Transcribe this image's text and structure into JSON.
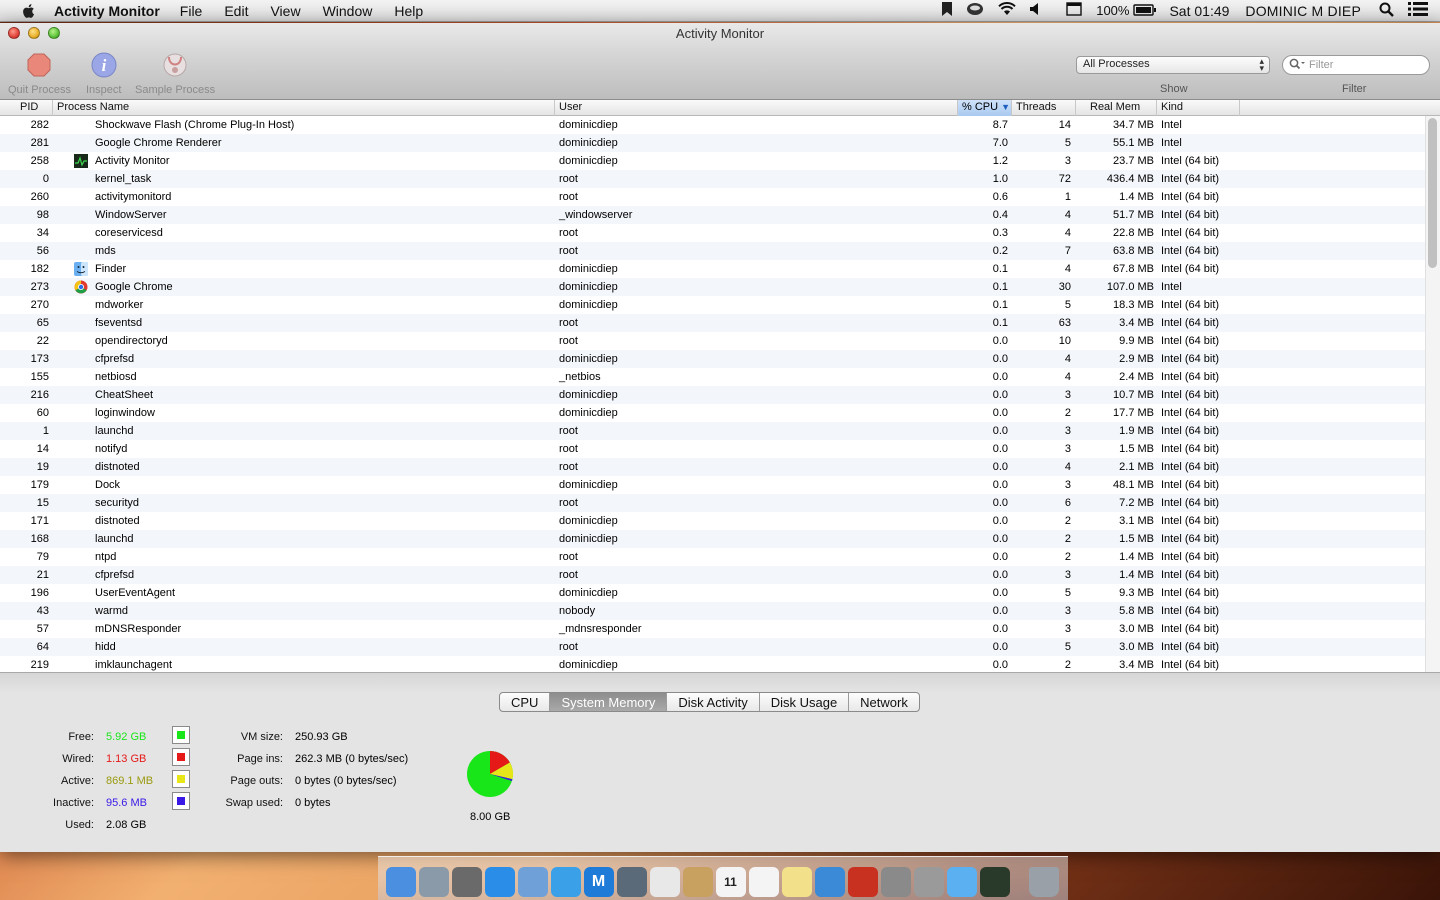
{
  "menubar": {
    "app_name": "Activity Monitor",
    "menus": [
      "File",
      "Edit",
      "View",
      "Window",
      "Help"
    ],
    "battery": "100%",
    "clock": "Sat 01:49",
    "user": "DOMINIC M DIEP"
  },
  "window": {
    "title": "Activity Monitor",
    "toolbar": {
      "quit_label": "Quit Process",
      "inspect_label": "Inspect",
      "sample_label": "Sample Process",
      "show_value": "All Processes",
      "show_label": "Show",
      "filter_placeholder": "Filter",
      "filter_label": "Filter"
    }
  },
  "table": {
    "columns": [
      "PID",
      "Process Name",
      "User",
      "% CPU",
      "Threads",
      "Real Mem",
      "Kind"
    ],
    "sorted_column": "% CPU",
    "rows": [
      {
        "pid": "282",
        "name": "Shockwave Flash (Chrome Plug-In Host)",
        "user": "dominicdiep",
        "cpu": "8.7",
        "threads": "14",
        "mem": "34.7 MB",
        "kind": "Intel",
        "icon": ""
      },
      {
        "pid": "281",
        "name": "Google Chrome Renderer",
        "user": "dominicdiep",
        "cpu": "7.0",
        "threads": "5",
        "mem": "55.1 MB",
        "kind": "Intel",
        "icon": ""
      },
      {
        "pid": "258",
        "name": "Activity Monitor",
        "user": "dominicdiep",
        "cpu": "1.2",
        "threads": "3",
        "mem": "23.7 MB",
        "kind": "Intel (64 bit)",
        "icon": "activity-monitor-icon"
      },
      {
        "pid": "0",
        "name": "kernel_task",
        "user": "root",
        "cpu": "1.0",
        "threads": "72",
        "mem": "436.4 MB",
        "kind": "Intel (64 bit)",
        "icon": ""
      },
      {
        "pid": "260",
        "name": "activitymonitord",
        "user": "root",
        "cpu": "0.6",
        "threads": "1",
        "mem": "1.4 MB",
        "kind": "Intel (64 bit)",
        "icon": ""
      },
      {
        "pid": "98",
        "name": "WindowServer",
        "user": "_windowserver",
        "cpu": "0.4",
        "threads": "4",
        "mem": "51.7 MB",
        "kind": "Intel (64 bit)",
        "icon": ""
      },
      {
        "pid": "34",
        "name": "coreservicesd",
        "user": "root",
        "cpu": "0.3",
        "threads": "4",
        "mem": "22.8 MB",
        "kind": "Intel (64 bit)",
        "icon": ""
      },
      {
        "pid": "56",
        "name": "mds",
        "user": "root",
        "cpu": "0.2",
        "threads": "7",
        "mem": "63.8 MB",
        "kind": "Intel (64 bit)",
        "icon": ""
      },
      {
        "pid": "182",
        "name": "Finder",
        "user": "dominicdiep",
        "cpu": "0.1",
        "threads": "4",
        "mem": "67.8 MB",
        "kind": "Intel (64 bit)",
        "icon": "finder-icon"
      },
      {
        "pid": "273",
        "name": "Google Chrome",
        "user": "dominicdiep",
        "cpu": "0.1",
        "threads": "30",
        "mem": "107.0 MB",
        "kind": "Intel",
        "icon": "chrome-icon"
      },
      {
        "pid": "270",
        "name": "mdworker",
        "user": "dominicdiep",
        "cpu": "0.1",
        "threads": "5",
        "mem": "18.3 MB",
        "kind": "Intel (64 bit)",
        "icon": ""
      },
      {
        "pid": "65",
        "name": "fseventsd",
        "user": "root",
        "cpu": "0.1",
        "threads": "63",
        "mem": "3.4 MB",
        "kind": "Intel (64 bit)",
        "icon": ""
      },
      {
        "pid": "22",
        "name": "opendirectoryd",
        "user": "root",
        "cpu": "0.0",
        "threads": "10",
        "mem": "9.9 MB",
        "kind": "Intel (64 bit)",
        "icon": ""
      },
      {
        "pid": "173",
        "name": "cfprefsd",
        "user": "dominicdiep",
        "cpu": "0.0",
        "threads": "4",
        "mem": "2.9 MB",
        "kind": "Intel (64 bit)",
        "icon": ""
      },
      {
        "pid": "155",
        "name": "netbiosd",
        "user": "_netbios",
        "cpu": "0.0",
        "threads": "4",
        "mem": "2.4 MB",
        "kind": "Intel (64 bit)",
        "icon": ""
      },
      {
        "pid": "216",
        "name": "CheatSheet",
        "user": "dominicdiep",
        "cpu": "0.0",
        "threads": "3",
        "mem": "10.7 MB",
        "kind": "Intel (64 bit)",
        "icon": ""
      },
      {
        "pid": "60",
        "name": "loginwindow",
        "user": "dominicdiep",
        "cpu": "0.0",
        "threads": "2",
        "mem": "17.7 MB",
        "kind": "Intel (64 bit)",
        "icon": ""
      },
      {
        "pid": "1",
        "name": "launchd",
        "user": "root",
        "cpu": "0.0",
        "threads": "3",
        "mem": "1.9 MB",
        "kind": "Intel (64 bit)",
        "icon": ""
      },
      {
        "pid": "14",
        "name": "notifyd",
        "user": "root",
        "cpu": "0.0",
        "threads": "3",
        "mem": "1.5 MB",
        "kind": "Intel (64 bit)",
        "icon": ""
      },
      {
        "pid": "19",
        "name": "distnoted",
        "user": "root",
        "cpu": "0.0",
        "threads": "4",
        "mem": "2.1 MB",
        "kind": "Intel (64 bit)",
        "icon": ""
      },
      {
        "pid": "179",
        "name": "Dock",
        "user": "dominicdiep",
        "cpu": "0.0",
        "threads": "3",
        "mem": "48.1 MB",
        "kind": "Intel (64 bit)",
        "icon": ""
      },
      {
        "pid": "15",
        "name": "securityd",
        "user": "root",
        "cpu": "0.0",
        "threads": "6",
        "mem": "7.2 MB",
        "kind": "Intel (64 bit)",
        "icon": ""
      },
      {
        "pid": "171",
        "name": "distnoted",
        "user": "dominicdiep",
        "cpu": "0.0",
        "threads": "2",
        "mem": "3.1 MB",
        "kind": "Intel (64 bit)",
        "icon": ""
      },
      {
        "pid": "168",
        "name": "launchd",
        "user": "dominicdiep",
        "cpu": "0.0",
        "threads": "2",
        "mem": "1.5 MB",
        "kind": "Intel (64 bit)",
        "icon": ""
      },
      {
        "pid": "79",
        "name": "ntpd",
        "user": "root",
        "cpu": "0.0",
        "threads": "2",
        "mem": "1.4 MB",
        "kind": "Intel (64 bit)",
        "icon": ""
      },
      {
        "pid": "21",
        "name": "cfprefsd",
        "user": "root",
        "cpu": "0.0",
        "threads": "3",
        "mem": "1.4 MB",
        "kind": "Intel (64 bit)",
        "icon": ""
      },
      {
        "pid": "196",
        "name": "UserEventAgent",
        "user": "dominicdiep",
        "cpu": "0.0",
        "threads": "5",
        "mem": "9.3 MB",
        "kind": "Intel (64 bit)",
        "icon": ""
      },
      {
        "pid": "43",
        "name": "warmd",
        "user": "nobody",
        "cpu": "0.0",
        "threads": "3",
        "mem": "5.8 MB",
        "kind": "Intel (64 bit)",
        "icon": ""
      },
      {
        "pid": "57",
        "name": "mDNSResponder",
        "user": "_mdnsresponder",
        "cpu": "0.0",
        "threads": "3",
        "mem": "3.0 MB",
        "kind": "Intel (64 bit)",
        "icon": ""
      },
      {
        "pid": "64",
        "name": "hidd",
        "user": "root",
        "cpu": "0.0",
        "threads": "5",
        "mem": "3.0 MB",
        "kind": "Intel (64 bit)",
        "icon": ""
      },
      {
        "pid": "219",
        "name": "imklaunchagent",
        "user": "dominicdiep",
        "cpu": "0.0",
        "threads": "2",
        "mem": "3.4 MB",
        "kind": "Intel (64 bit)",
        "icon": ""
      }
    ]
  },
  "bottom": {
    "tabs": [
      "CPU",
      "System Memory",
      "Disk Activity",
      "Disk Usage",
      "Network"
    ],
    "active_tab": "System Memory",
    "memory": {
      "free_label": "Free:",
      "free_value": "5.92 GB",
      "free_color": "#19e619",
      "wired_label": "Wired:",
      "wired_value": "1.13 GB",
      "wired_color": "#e61919",
      "active_label": "Active:",
      "active_value": "869.1 MB",
      "active_color": "#e6e619",
      "inactive_label": "Inactive:",
      "inactive_value": "95.6 MB",
      "inactive_color": "#3a19e6",
      "used_label": "Used:",
      "used_value": "2.08 GB",
      "vm_label": "VM size:",
      "vm_value": "250.93 GB",
      "pageins_label": "Page ins:",
      "pageins_value": "262.3 MB (0 bytes/sec)",
      "pageouts_label": "Page outs:",
      "pageouts_value": "0 bytes (0 bytes/sec)",
      "swap_label": "Swap used:",
      "swap_value": "0 bytes",
      "total": "8.00 GB"
    }
  },
  "dock": {
    "items": [
      "finder-icon",
      "launchpad-icon",
      "mission-control-icon",
      "app-store-icon",
      "preview-icon",
      "safari-icon",
      "mail-icon",
      "facetime-icon",
      "chrome-icon",
      "contacts-icon",
      "calendar-icon",
      "reminders-icon",
      "notes-icon",
      "itunes-icon",
      "photo-booth-icon",
      "iphoto-icon",
      "system-preferences-icon",
      "messages-icon",
      "activity-monitor-icon",
      "trash-icon"
    ],
    "colors": [
      "#4a8fe0",
      "#8a9aa8",
      "#6a6a6a",
      "#2a8ee8",
      "#6fa0d8",
      "#3aa0e8",
      "#1f7bd8",
      "#5a6a78",
      "#e8e8e8",
      "#c8a060",
      "#f4f4f4",
      "#f4f4f4",
      "#f2e08a",
      "#3a8ad8",
      "#c83020",
      "#8a8a8a",
      "#9a9a9a",
      "#5ab0f0",
      "#2a3a2a",
      "#9aa0a8"
    ],
    "calendar_day": "11"
  }
}
